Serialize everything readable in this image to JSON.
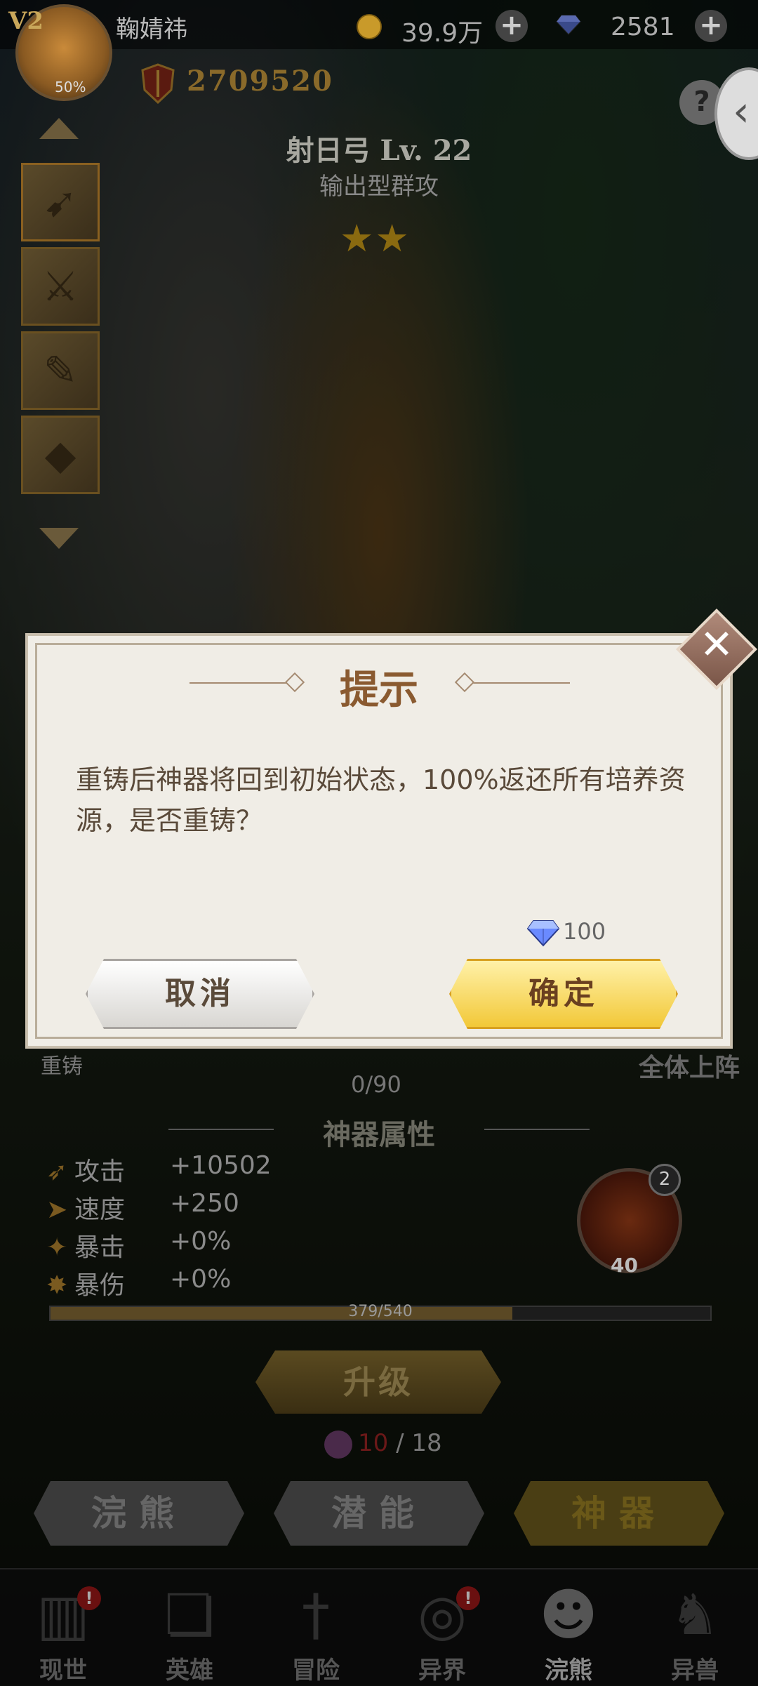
{
  "header": {
    "vip": "V2",
    "avatar_progress": "50%",
    "player_name": "鞠婧祎",
    "gold": "39.9万",
    "gems": "2581",
    "power": "2709520"
  },
  "artifact": {
    "name": "射日弓 Lv. 22",
    "type": "输出型群攻",
    "stars": "★★"
  },
  "background": {
    "recast_label": "重铸",
    "progress": "0/90",
    "deploy_all": "全体上阵",
    "attr_title": "神器属性",
    "attributes": [
      {
        "label": "攻击",
        "value": "+10502"
      },
      {
        "label": "速度",
        "value": "+250"
      },
      {
        "label": "暴击",
        "value": "+0%"
      },
      {
        "label": "暴伤",
        "value": "+0%"
      }
    ],
    "exp": {
      "text": "379/540",
      "fraction": 0.7
    },
    "skill_level": "40",
    "skill_badge": "2",
    "upgrade_label": "升级",
    "material_have": "10",
    "material_need": " / 18",
    "sub_tabs": [
      "浣熊",
      "潜能",
      "神器"
    ]
  },
  "bottom_nav": [
    {
      "label": "现世",
      "badge": "!"
    },
    {
      "label": "英雄",
      "badge": ""
    },
    {
      "label": "冒险",
      "badge": ""
    },
    {
      "label": "异界",
      "badge": "!"
    },
    {
      "label": "浣熊",
      "badge": ""
    },
    {
      "label": "异兽",
      "badge": ""
    }
  ],
  "dialog": {
    "title": "提示",
    "message": "重铸后神器将回到初始状态，100%返还所有培养资源，是否重铸？",
    "cost": "100",
    "cancel_label": "取消",
    "confirm_label": "确定",
    "close_symbol": "✕"
  },
  "colors": {
    "dialog_bg": "#f0ede6",
    "title_color": "#8a5a30",
    "confirm_gold": "#f2c838"
  }
}
